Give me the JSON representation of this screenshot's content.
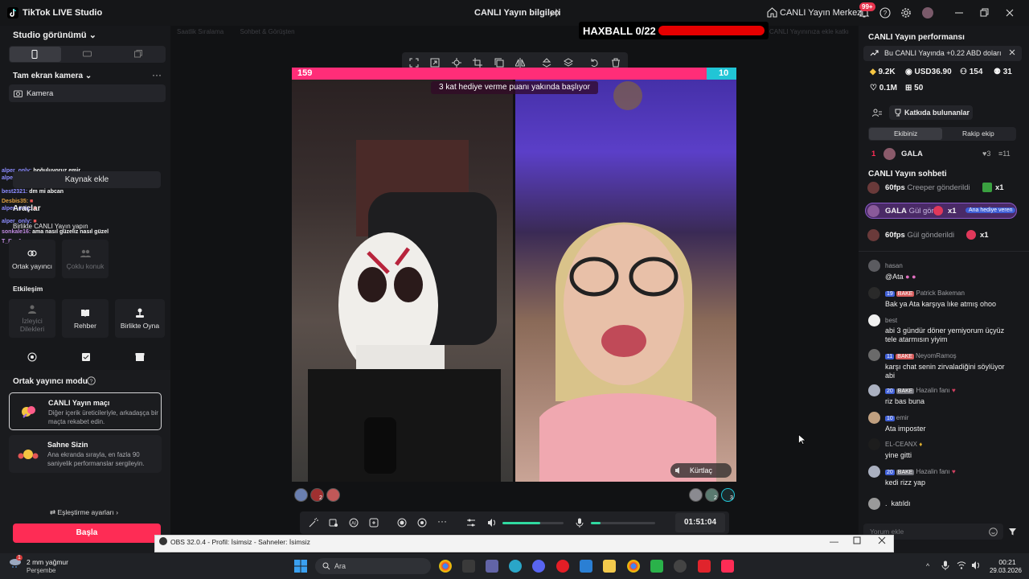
{
  "titlebar": {
    "app_title": "TikTok LIVE Studio",
    "live_info": "CANLI Yayın bilgileri",
    "live_center": "CANLI Yayın Merkezi",
    "notif_count": "99+"
  },
  "sidebar": {
    "studio_view": "Studio görünümü",
    "fullscreen_camera": "Tam ekran kamera",
    "camera": "Kamera",
    "add_source": "Kaynak ekle",
    "tools_title": "Araçlar",
    "together_live": "Birlikte CANLI Yayın yapın",
    "tools": [
      {
        "label": "Ortak yayıncı"
      },
      {
        "label": "Çoklu konuk"
      }
    ],
    "interaction_title": "Etkileşim",
    "interaction": [
      {
        "label": "İzleyici Dilekleri"
      },
      {
        "label": "Rehber"
      },
      {
        "label": "Birlikte Oyna"
      }
    ],
    "cohost_mode_title": "Ortak yayıncı modu",
    "modes": [
      {
        "title": "CANLI Yayın maçı",
        "desc": "Diğer içerik üreticileriyle, arkadaşça bir maçta rekabet edin."
      },
      {
        "title": "Sahne Sizin",
        "desc": "Ana ekranda sırayla, en fazla 90 saniyelik performanslar sergileyin."
      }
    ],
    "match_settings": "Eşleştirme ayarları",
    "start": "Başla",
    "overlay_chat": [
      {
        "user": "alper_only:",
        "msg": "boğuluyoruz emir"
      },
      {
        "user": "alper_only:",
        "msg": ""
      },
      {
        "user": "best2321:",
        "msg": "dm mi abcan"
      },
      {
        "user": "Desbis35:",
        "msg": ""
      },
      {
        "user": "alper_only:",
        "msg": ""
      },
      {
        "user": "alper_only:",
        "msg": ""
      },
      {
        "user": "sonkale16:",
        "msg": "ama nasıl güzeliz nasıl güzel"
      },
      {
        "user": "T_Baş1:",
        "msg": ""
      }
    ]
  },
  "center": {
    "tabs": [
      "Saatlik Sıralama",
      "Sohbet & Görüşten",
      "CANLI Yayınınıza ekle katkı"
    ],
    "haxball": "HAXBALL 0/22",
    "score_left": "159",
    "score_right": "10",
    "battle_banner": "3 kat hediye verme puanı yakında başlıyor",
    "kurtlac": "Kürtlaç",
    "timer": "01:51:04",
    "left_avatar_counts": [
      "2"
    ],
    "right_avatar_counts": [
      "2",
      "3"
    ]
  },
  "right": {
    "performance_title": "CANLI Yayın performansı",
    "perf_note": "Bu CANLI Yayında +0.22 ABD doları",
    "stats": {
      "diamonds": "9.2K",
      "usd": "USD36.90",
      "viewers": "154",
      "new_followers": "31",
      "likes": "0.1M",
      "gifters": "50"
    },
    "contributors_btn": "Katkıda bulunanlar",
    "team_tabs": [
      "Ekibiniz",
      "Rakip ekip"
    ],
    "rank_row": {
      "rank": "1",
      "name": "GALA",
      "hearts": "3",
      "score": "11"
    },
    "chat_title": "CANLI Yayın sohbeti",
    "gifts": [
      {
        "user": "60fps",
        "text": "Creeper gönderildi",
        "count": "x1"
      },
      {
        "user": "GALA",
        "text": "Gül gön",
        "count": "x1",
        "tag": "Ana hediye veren"
      },
      {
        "user": "60fps",
        "text": "Gül gönderildi",
        "count": "x1"
      }
    ],
    "comments": [
      {
        "user": "hasan",
        "text": "@Ata"
      },
      {
        "level": "19",
        "tag": "BAKE",
        "user": "Patrick Bakeman",
        "text": "Bak ya Ata karşıya lıke atmış ohoo"
      },
      {
        "user": "best",
        "text": "abi 3 gündür döner yemiyorum üçyüz tele atarmısın yiyim"
      },
      {
        "level": "11",
        "tag": "BAKE",
        "user": "NeyomRamoş",
        "text": "karşı chat senin zirvaladiğini söylüyor abi"
      },
      {
        "level": "20",
        "tag": "BAKE",
        "user": "Hazalin fanı",
        "text": "riz bas buna"
      },
      {
        "level": "10",
        "user": "emir",
        "text": "Ata imposter"
      },
      {
        "user": "EL-CEANX",
        "text": "yine gitti"
      },
      {
        "level": "20",
        "tag": "BAKE",
        "user": "Hazalin fanı",
        "text": "kedi rizz yap"
      },
      {
        "user": ".",
        "text": "katıldı"
      }
    ],
    "comment_placeholder": "Yorum ekle"
  },
  "obs": {
    "title": "OBS 32.0.4 - Profil: İsimsiz - Sahneler: İsimsiz"
  },
  "taskbar": {
    "weather_temp": "2 mm yağmur",
    "weather_day": "Perşembe",
    "weather_badge": "1",
    "search": "Ara",
    "time": "00:21",
    "date": "29.03.2026"
  },
  "colors": {
    "accent": "#fe2c55",
    "haxball_bar": "#e60000",
    "score_pink": "#ff2d78",
    "score_cyan": "#21c5d6"
  }
}
